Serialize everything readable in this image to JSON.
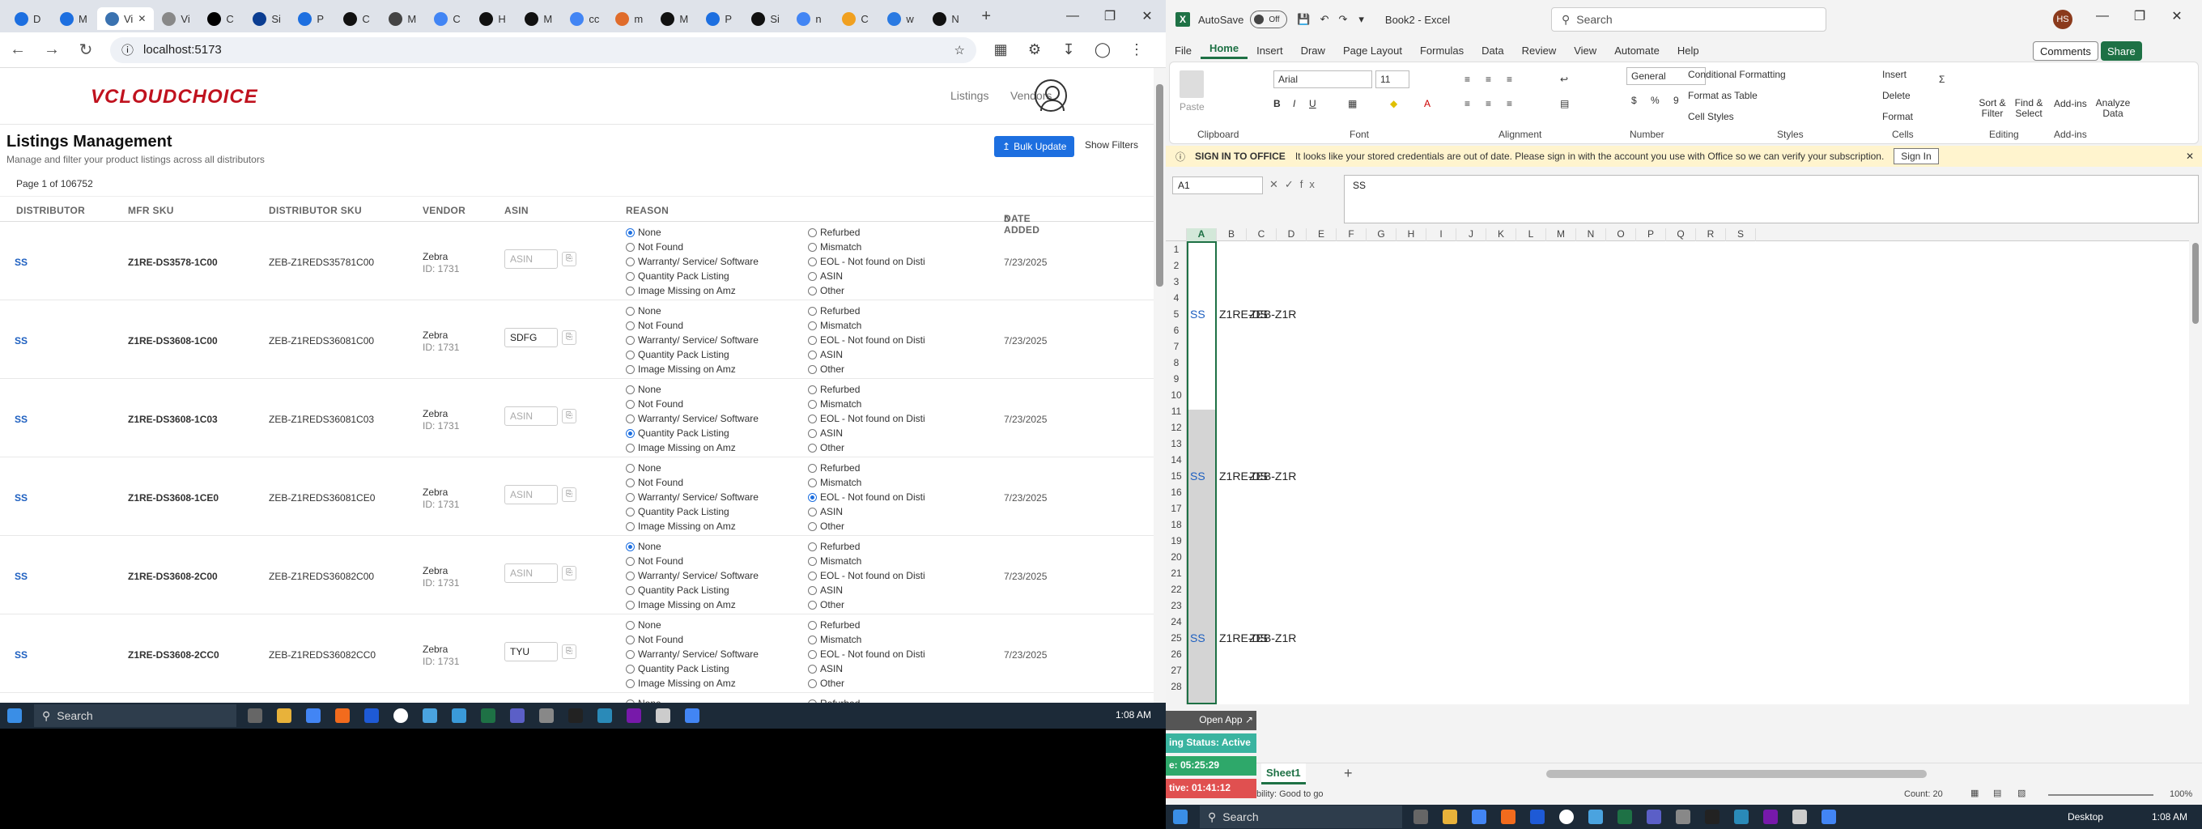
{
  "browser": {
    "tabs": [
      {
        "label": "D",
        "color": "#1d6fe0"
      },
      {
        "label": "M",
        "color": "#1d6fe0"
      },
      {
        "label": "Vi",
        "color": "#3a72b0",
        "active": true
      },
      {
        "label": "Vi",
        "color": "#888888"
      },
      {
        "label": "C",
        "color": "#000000"
      },
      {
        "label": "Si",
        "color": "#0b3d91"
      },
      {
        "label": "P",
        "color": "#1d6fe0"
      },
      {
        "label": "C",
        "color": "#111111"
      },
      {
        "label": "M",
        "color": "#444444"
      },
      {
        "label": "C",
        "color": "#4285f4"
      },
      {
        "label": "H",
        "color": "#111111"
      },
      {
        "label": "M",
        "color": "#111111"
      },
      {
        "label": "cc",
        "color": "#4285f4"
      },
      {
        "label": "m",
        "color": "#e06c2b"
      },
      {
        "label": "M",
        "color": "#111111"
      },
      {
        "label": "P",
        "color": "#1d6fe0"
      },
      {
        "label": "Si",
        "color": "#111111"
      },
      {
        "label": "n",
        "color": "#4285f4"
      },
      {
        "label": "C",
        "color": "#f0a020"
      },
      {
        "label": "w",
        "color": "#2a7ae2"
      },
      {
        "label": "N",
        "color": "#111111"
      }
    ],
    "new_tab": "+",
    "url": "localhost:5173"
  },
  "app": {
    "logo": "VCLOUDCHOICE",
    "nav": [
      "Listings",
      "Vendors"
    ],
    "title": "Listings Management",
    "subtitle": "Manage and filter your product listings across all distributors",
    "bulk_update": "Bulk Update",
    "show_filters": "Show Filters",
    "page_info": "Page 1 of 106752",
    "headers": {
      "distributor": "DISTRIBUTOR",
      "mfr_sku": "MFR SKU",
      "dist_sku": "DISTRIBUTOR SKU",
      "vendor": "VENDOR",
      "asin": "ASIN",
      "reason": "REASON",
      "date_added": "DATE ADDED"
    },
    "asin_placeholder": "ASIN",
    "reasons_left": [
      "None",
      "Not Found",
      "Warranty/ Service/ Software",
      "Quantity Pack Listing",
      "Image Missing on Amz"
    ],
    "reasons_right": [
      "Refurbed",
      "Mismatch",
      "EOL - Not found on Disti",
      "ASIN",
      "Other"
    ],
    "rows": [
      {
        "dist": "SS",
        "mfr": "Z1RE-DS3578-1C00",
        "dsku": "ZEB-Z1REDS35781C00",
        "vendor": "Zebra",
        "vid": "ID: 1731",
        "asin": "",
        "selected": "None",
        "date": "7/23/2025"
      },
      {
        "dist": "SS",
        "mfr": "Z1RE-DS3608-1C00",
        "dsku": "ZEB-Z1REDS36081C00",
        "vendor": "Zebra",
        "vid": "ID: 1731",
        "asin": "SDFG",
        "selected": "",
        "date": "7/23/2025"
      },
      {
        "dist": "SS",
        "mfr": "Z1RE-DS3608-1C03",
        "dsku": "ZEB-Z1REDS36081C03",
        "vendor": "Zebra",
        "vid": "ID: 1731",
        "asin": "",
        "selected": "Quantity Pack Listing",
        "date": "7/23/2025"
      },
      {
        "dist": "SS",
        "mfr": "Z1RE-DS3608-1CE0",
        "dsku": "ZEB-Z1REDS36081CE0",
        "vendor": "Zebra",
        "vid": "ID: 1731",
        "asin": "",
        "selected": "EOL - Not found on Disti",
        "date": "7/23/2025"
      },
      {
        "dist": "SS",
        "mfr": "Z1RE-DS3608-2C00",
        "dsku": "ZEB-Z1REDS36082C00",
        "vendor": "Zebra",
        "vid": "ID: 1731",
        "asin": "",
        "selected": "None",
        "date": "7/23/2025"
      },
      {
        "dist": "SS",
        "mfr": "Z1RE-DS3608-2CC0",
        "dsku": "ZEB-Z1REDS36082CC0",
        "vendor": "Zebra",
        "vid": "ID: 1731",
        "asin": "TYU",
        "selected": "",
        "date": "7/23/2025"
      }
    ],
    "partial_row": [
      "None",
      "Refurbed"
    ]
  },
  "taskbar_left": {
    "search": "Search",
    "time": "1:08 AM"
  },
  "excel": {
    "autosave": "AutoSave",
    "autosave_state": "Off",
    "title": "Book2 - Excel",
    "search": "Search",
    "avatar": "HS",
    "menu": [
      "File",
      "Home",
      "Insert",
      "Draw",
      "Page Layout",
      "Formulas",
      "Data",
      "Review",
      "View",
      "Automate",
      "Help"
    ],
    "comments": "Comments",
    "share": "Share",
    "ribbon": {
      "paste": "Paste",
      "font": "Arial",
      "size": "11",
      "number_format": "General",
      "cond_format": "Conditional Formatting",
      "format_table": "Format as Table",
      "cell_styles": "Cell Styles",
      "insert": "Insert",
      "delete": "Delete",
      "format": "Format",
      "sort_filter": "Sort & Filter",
      "find_select": "Find & Select",
      "addins": "Add-ins",
      "analyze": "Analyze Data",
      "groups": [
        "Clipboard",
        "Font",
        "Alignment",
        "Number",
        "Styles",
        "Cells",
        "Editing",
        "Add-ins"
      ]
    },
    "message": {
      "title": "SIGN IN TO OFFICE",
      "text": "It looks like your stored credentials are out of date. Please sign in with the account you use with Office so we can verify your subscription.",
      "button": "Sign In"
    },
    "namebox": "A1",
    "formula": "SS",
    "columns": [
      "A",
      "B",
      "C",
      "D",
      "E",
      "F",
      "G",
      "H",
      "I",
      "J",
      "K",
      "L",
      "M",
      "N",
      "O",
      "P",
      "Q",
      "R",
      "S"
    ],
    "cells": [
      {
        "row": 5,
        "a": "SS",
        "b": "Z1RE-DS",
        "c": "ZEB-Z1R"
      },
      {
        "row": 15,
        "a": "SS",
        "b": "Z1RE-DS",
        "c": "ZEB-Z1R"
      },
      {
        "row": 25,
        "a": "SS",
        "b": "Z1RE-DS",
        "c": "ZEB-Z1R"
      }
    ],
    "sheet": "Sheet1",
    "add_sheet": "+",
    "status_left": "bility: Good to go",
    "count": "Count: 20",
    "zoom": "100%",
    "overlay": {
      "open_app": "Open App",
      "status": "ing Status: Active",
      "timer1": "e: 05:25:29",
      "timer2": "tive: 01:41:12"
    },
    "taskbar": {
      "search": "Search",
      "desktop": "Desktop",
      "time": "1:08 AM"
    }
  }
}
